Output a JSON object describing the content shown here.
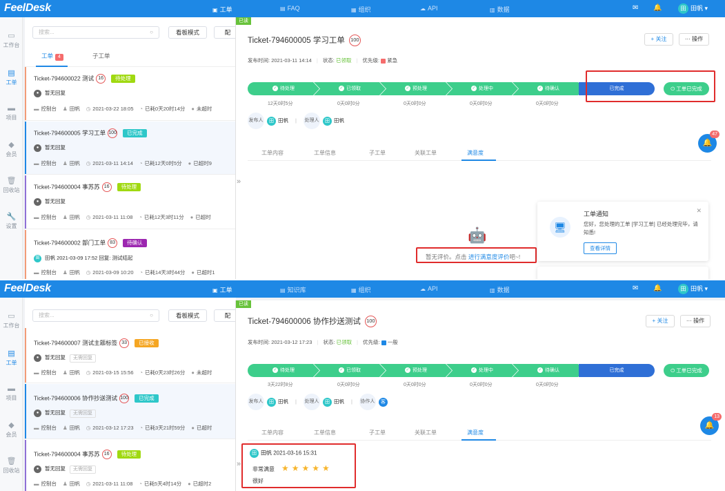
{
  "app": {
    "logo": "FeelDesk",
    "user": "田帆",
    "user_initial": "田"
  },
  "s1": {
    "nav": [
      {
        "label": "工单",
        "icon": "ticket-icon"
      },
      {
        "label": "FAQ",
        "icon": "faq-icon"
      },
      {
        "label": "组织",
        "icon": "org-icon"
      },
      {
        "label": "API",
        "icon": "api-icon"
      },
      {
        "label": "数据",
        "icon": "chart-icon"
      }
    ],
    "search_placeholder": "搜索...",
    "board_btn": "看板模式",
    "config_btn": "配",
    "tabs": {
      "ticket": "工单",
      "ticket_count": "4",
      "subticket": "子工单"
    },
    "cards": [
      {
        "title": "Ticket-794600022",
        "subject": "测试",
        "score": "16",
        "status": "待处理",
        "reply": "暂无回复",
        "source": "控制台",
        "owner": "田帆",
        "time": "2021-03-22 18:05",
        "elapsed": "已耗0天20时14分",
        "timeout": "未超时"
      },
      {
        "title": "Ticket-794600005",
        "subject": "学习工单",
        "score": "100",
        "status": "已完成",
        "reply": "暂无回复",
        "source": "控制台",
        "owner": "田帆",
        "time": "2021-03-11 14:14",
        "elapsed": "已耗12天0时5分",
        "timeout": "已超时9"
      },
      {
        "title": "Ticket-794600004",
        "subject": "事苏苏",
        "score": "16",
        "status": "待处理",
        "reply": "暂无回复",
        "source": "控制台",
        "owner": "田帆",
        "time": "2021-03-11 11:08",
        "elapsed": "已耗12天3时11分",
        "timeout": "已超时"
      },
      {
        "title": "Ticket-794600002",
        "subject": "部门工单",
        "score": "83",
        "status": "待确认",
        "reply": "田帆 2021-03-09 17:52 回复: 测试结起",
        "source": "控制台",
        "owner": "田帆",
        "time": "2021-03-09 10:20",
        "elapsed": "已耗14天3时44分",
        "timeout": "已超时1"
      }
    ],
    "detail": {
      "read_tag": "已读",
      "title": "Ticket-794600005",
      "subject": "学习工单",
      "score": "100",
      "follow": "+ 关注",
      "ops": "··· 操作",
      "meta_pub_label": "发布时间:",
      "meta_pub": "2021-03-11 14:14",
      "meta_status_label": "状态:",
      "meta_status": "已领取",
      "meta_pri_label": "优先级:",
      "meta_pri": "紧急",
      "steps": [
        "待处理",
        "已领取",
        "预处理",
        "处理中",
        "待确认",
        "已完成"
      ],
      "step_times": [
        "12天0时5分",
        "0天0时0分",
        "0天0时0分",
        "0天0时0分",
        "0天0时0分"
      ],
      "done_btn": "工单已完成",
      "publisher_label": "发布人",
      "publisher": "田帆",
      "handler_label": "处理人",
      "handler": "田帆",
      "tabs": [
        "工单内容",
        "工单信息",
        "子工单",
        "关联工单",
        "满意度"
      ],
      "empty_text": "暂无评价。点击",
      "empty_link": "进行满意度评价",
      "empty_tail": "吧~!",
      "bell_count": "47",
      "notif_title": "工单通知",
      "notif_body": "您好，您处理的工单 [学习工单] 已经处理完毕，请知悉!",
      "notif_btn": "查看详情"
    }
  },
  "s2": {
    "nav": [
      {
        "label": "工单",
        "icon": "ticket-icon"
      },
      {
        "label": "知识库",
        "icon": "book-icon"
      },
      {
        "label": "组织",
        "icon": "org-icon"
      },
      {
        "label": "API",
        "icon": "api-icon"
      },
      {
        "label": "数据",
        "icon": "chart-icon"
      }
    ],
    "search_placeholder": "搜索...",
    "board_btn": "看板模式",
    "config_btn": "配",
    "cards": [
      {
        "title": "Ticket-794600007",
        "subject": "测试主题标签",
        "score": "33",
        "status": "已接收",
        "reply": "暂无回复",
        "tag": "无需回复",
        "source": "控制台",
        "owner": "田帆",
        "time": "2021-03-15 15:56",
        "elapsed": "已耗0天23时26分",
        "timeout": "未超时"
      },
      {
        "title": "Ticket-794600006",
        "subject": "协作抄送测试",
        "score": "100",
        "status": "已完成",
        "reply": "暂无回复",
        "tag": "无需回复",
        "source": "控制台",
        "owner": "田帆",
        "time": "2021-03-12 17:23",
        "elapsed": "已耗3天21时59分",
        "timeout": "已超时"
      },
      {
        "title": "Ticket-794600004",
        "subject": "事苏苏",
        "score": "16",
        "status": "待处理",
        "reply": "暂无回复",
        "tag": "无需回复",
        "source": "控制台",
        "owner": "田帆",
        "time": "2021-03-11 11:08",
        "elapsed": "已耗5天4时14分",
        "timeout": "已超时2"
      }
    ],
    "detail": {
      "read_tag": "已读",
      "title": "Ticket-794600006",
      "subject": "协作抄送测试",
      "score": "100",
      "follow": "+ 关注",
      "ops": "··· 操作",
      "meta_pub_label": "发布时间:",
      "meta_pub": "2021-03-12 17:23",
      "meta_status_label": "状态:",
      "meta_status": "已领取",
      "meta_pri_label": "优先级:",
      "meta_pri": "一般",
      "steps": [
        "待处理",
        "已领取",
        "预处理",
        "处理中",
        "待确认",
        "已完成"
      ],
      "step_times": [
        "3天22时8分",
        "0天0时0分",
        "0天0时0分",
        "0天0时0分",
        "0天0时0分"
      ],
      "done_btn": "工单已完成",
      "publisher_label": "发布人",
      "publisher": "田帆",
      "handler_label": "处理人",
      "handler": "田帆",
      "collab_label": "协作人",
      "collab": "客",
      "tabs": [
        "工单内容",
        "工单信息",
        "子工单",
        "关联工单",
        "满意度"
      ],
      "bell_count": "13",
      "rating_user": "田帆",
      "rating_time": "2021-03-16 15:31",
      "rating_level": "非常满意",
      "rating_stars": "★★★★★",
      "rating_comment": "很好"
    }
  },
  "leftnav": [
    {
      "label": "工作台",
      "icon": "dashboard-icon"
    },
    {
      "label": "工单",
      "icon": "ticket-icon"
    },
    {
      "label": "项目",
      "icon": "folder-icon"
    },
    {
      "label": "会员",
      "icon": "diamond-icon"
    },
    {
      "label": "回收站",
      "icon": "trash-icon"
    },
    {
      "label": "设置",
      "icon": "wrench-icon"
    }
  ],
  "colors": {
    "brand": "#1e88e5",
    "green": "#3dce8b",
    "done": "#2f6fd6",
    "pending": "#a0d911",
    "confirm": "#9c27b0",
    "received": "#f5a623",
    "urgent": "#f56c6c",
    "normal": "#1e88e5",
    "highlight": "#e02b2b"
  }
}
